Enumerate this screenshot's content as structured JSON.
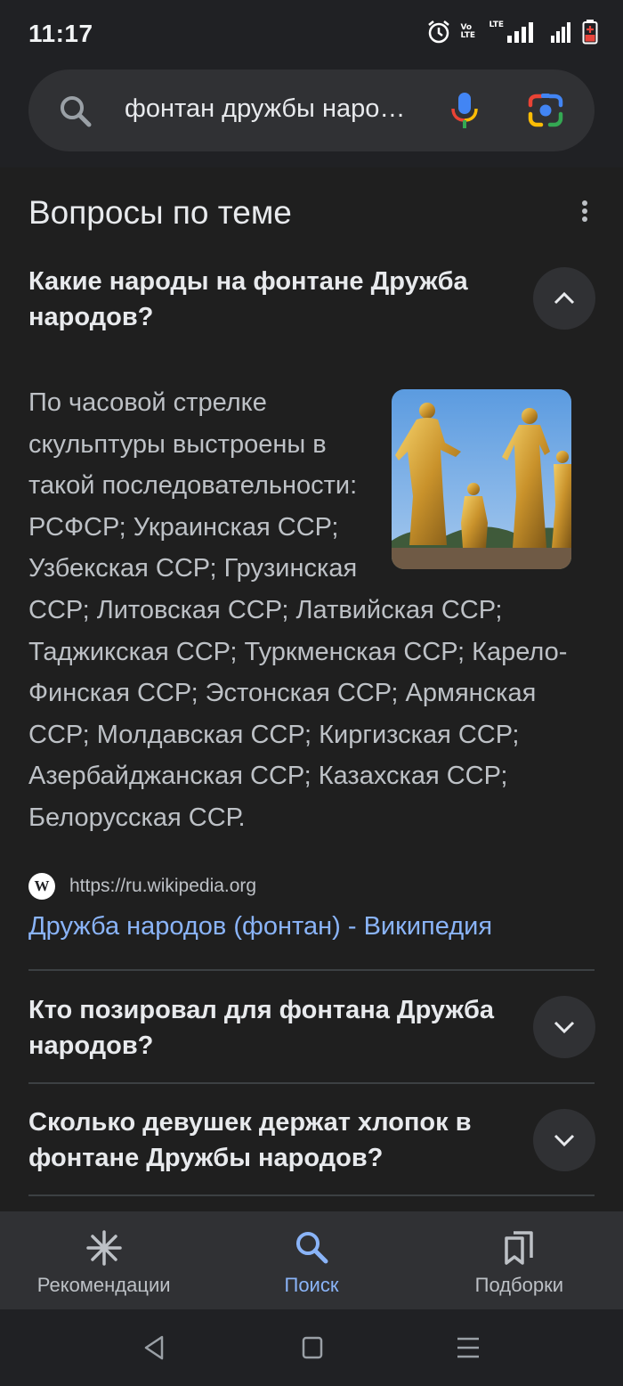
{
  "status_bar": {
    "time": "11:17",
    "network_label": "LTE",
    "volte_label": "Vo LTE"
  },
  "search": {
    "query": "фонтан дружбы наро…"
  },
  "related_questions": {
    "title": "Вопросы по теме",
    "items": [
      {
        "question": "Какие народы на фонтане Дружба народов?",
        "expanded": true,
        "answer": "По часовой стрелке скульптуры выстроены в такой последовательности: РСФСР; Украинская ССР; Узбекская ССР; Грузинская ССР; Литовская ССР; Латвийская ССР; Таджикская ССР; Туркменская ССР; Карело-Финская ССР; Эстонская ССР; Армянская ССР; Молдавская ССР; Киргизская ССР; Азербайджанская ССР; Казахская ССР; Белорусская ССР.",
        "source_logo": "W",
        "source_url": "https://ru.wikipedia.org",
        "source_title": "Дружба народов (фонтан) - Википедия"
      },
      {
        "question": "Кто позировал для фонтана Дружба народов?",
        "expanded": false
      },
      {
        "question": "Сколько девушек держат хлопок в фонтане Дружбы народов?",
        "expanded": false
      }
    ]
  },
  "bottom_nav": {
    "items": [
      {
        "label": "Рекомендации",
        "icon": "asterisk-icon",
        "active": false
      },
      {
        "label": "Поиск",
        "icon": "search-icon",
        "active": true
      },
      {
        "label": "Подборки",
        "icon": "collections-icon",
        "active": false
      }
    ]
  },
  "colors": {
    "background": "#1f1f1f",
    "link": "#8ab4f8",
    "surface": "#303134",
    "active": "#8ab4f8"
  }
}
